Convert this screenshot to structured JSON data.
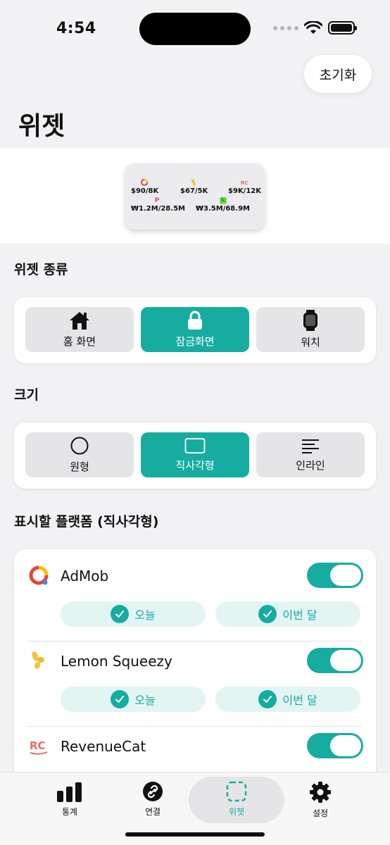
{
  "status": {
    "time": "4:54"
  },
  "header": {
    "reset_label": "초기화",
    "title": "위젯"
  },
  "preview": {
    "row1": [
      "$90/8K",
      "$67/5K",
      "$9K/12K"
    ],
    "row2": [
      "₩1.2M/28.5M",
      "₩3.5M/68.9M"
    ],
    "icon_p": "P",
    "icon_k": "k"
  },
  "widget_type": {
    "label": "위젯 종류",
    "options": [
      {
        "label": "홈 화면"
      },
      {
        "label": "잠금화면"
      },
      {
        "label": "워치"
      }
    ],
    "selected": "잠금화면"
  },
  "size": {
    "label": "크기",
    "options": [
      {
        "label": "원형"
      },
      {
        "label": "직사각형"
      },
      {
        "label": "인라인"
      }
    ],
    "selected": "직사각형"
  },
  "platforms": {
    "label": "표시할 플랫폼 (직사각형)",
    "items": [
      {
        "name": "AdMob",
        "enabled": true,
        "today": "오늘",
        "month": "이번 달"
      },
      {
        "name": "Lemon Squeezy",
        "enabled": true,
        "today": "오늘",
        "month": "이번 달"
      },
      {
        "name": "RevenueCat",
        "enabled": true
      }
    ]
  },
  "tabbar": {
    "tabs": [
      {
        "label": "통계"
      },
      {
        "label": "연결"
      },
      {
        "label": "위젯"
      },
      {
        "label": "설정"
      }
    ],
    "active": "위젯"
  },
  "colors": {
    "accent": "#16ada0",
    "chip_bg": "#e3f5f3"
  }
}
